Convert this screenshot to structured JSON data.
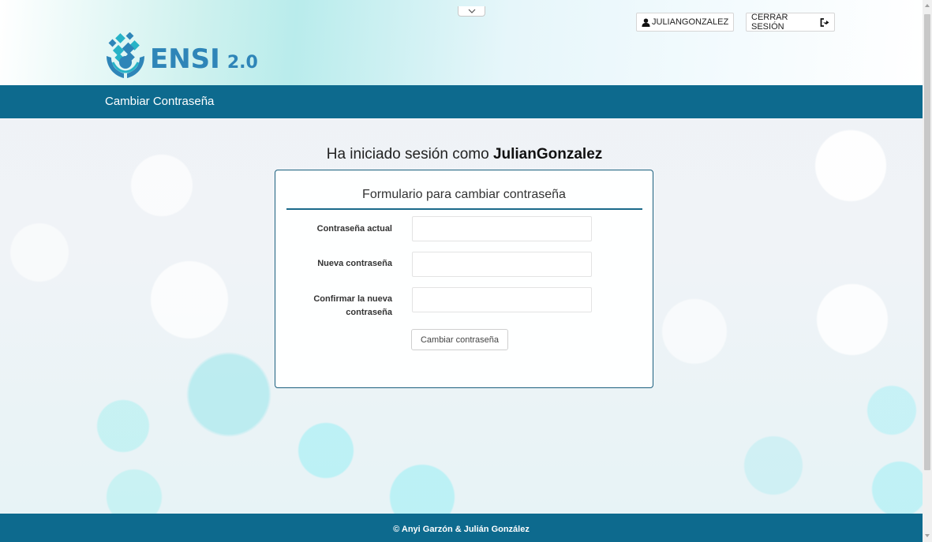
{
  "header": {
    "brand_name": "ENSI",
    "brand_version": "2.0",
    "user_label": "JULIANGONZALEZ",
    "logout_label": "CERRAR SESIÓN"
  },
  "titlebar": {
    "title": "Cambiar Contraseña"
  },
  "main": {
    "greeting_prefix": "Ha iniciado sesión como",
    "greeting_user": "JulianGonzalez"
  },
  "form": {
    "title": "Formulario para cambiar contraseña",
    "fields": [
      {
        "label": "Contraseña actual",
        "value": "",
        "placeholder": ""
      },
      {
        "label": "Nueva contraseña",
        "value": "",
        "placeholder": ""
      },
      {
        "label": "Confirmar la nueva contraseña",
        "value": "",
        "placeholder": ""
      }
    ],
    "submit_label": "Cambiar contraseña"
  },
  "footer": {
    "credit": "© Anyi Garzón & Julián González"
  },
  "colors": {
    "primary": "#0d6a8e",
    "brand": "#2e85b8",
    "card_border": "#1b5f7e"
  },
  "icons": {
    "user": "user-icon",
    "logout": "sign-out-icon",
    "collapse": "chevron-down-icon",
    "logo": "ensi-logo-icon"
  }
}
